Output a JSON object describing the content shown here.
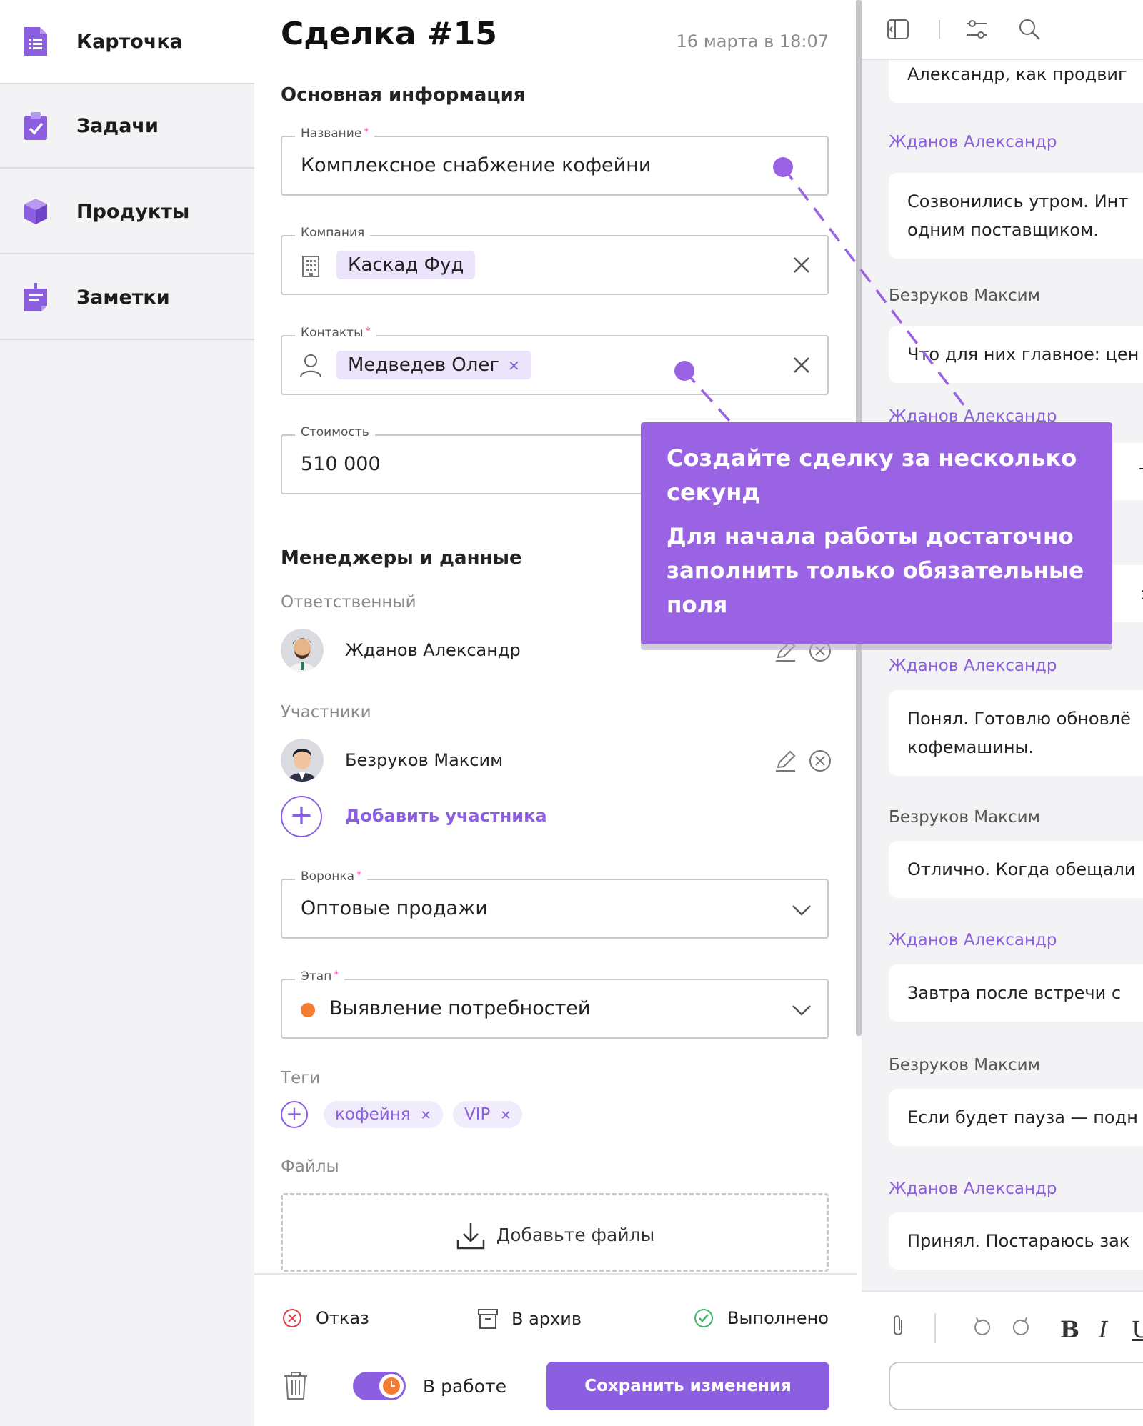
{
  "sidebar": {
    "items": [
      {
        "label": "Карточка",
        "icon": "card-document-icon",
        "active": true
      },
      {
        "label": "Задачи",
        "icon": "task-clipboard-icon",
        "active": false
      },
      {
        "label": "Продукты",
        "icon": "product-box-icon",
        "active": false
      },
      {
        "label": "Заметки",
        "icon": "note-icon",
        "active": false
      }
    ]
  },
  "deal": {
    "title": "Сделка #15",
    "date": "16 марта в 18:07"
  },
  "main_info": {
    "section_title": "Основная информация",
    "name": {
      "label": "Название",
      "required_mark": "*",
      "value": "Комплексное снабжение кофейни"
    },
    "company": {
      "label": "Компания",
      "value": "Каскад Фуд"
    },
    "contacts": {
      "label": "Контакты",
      "required_mark": "*",
      "value": "Медведев Олег"
    },
    "cost": {
      "label": "Стоимость",
      "value": "510 000"
    }
  },
  "managers": {
    "section_title": "Менеджеры и данные",
    "responsible_label": "Ответственный",
    "responsible": "Жданов Александр",
    "participants_label": "Участники",
    "participants": [
      "Безруков Максим"
    ],
    "add_participant": "Добавить участника"
  },
  "pipeline": {
    "label": "Воронка",
    "required_mark": "*",
    "value": "Оптовые продажи"
  },
  "stage": {
    "label": "Этап",
    "required_mark": "*",
    "value": "Выявление потребностей",
    "dot_color": "#f47b30"
  },
  "tags": {
    "label": "Теги",
    "items": [
      "кофейня",
      "VIP"
    ]
  },
  "files": {
    "label": "Файлы",
    "dropzone": "Добавьте файлы"
  },
  "footer": {
    "reject": "Отказ",
    "archive": "В архив",
    "done": "Выполнено",
    "status": "В работе",
    "save": "Сохранить изменения"
  },
  "chat": {
    "messages": [
      {
        "author": "",
        "text": "Александр, как продвиг"
      },
      {
        "author": "Жданов Александр",
        "text": "Созвонились утром. Инт\nодним поставщиком."
      },
      {
        "author": "Безруков Максим",
        "text": "Что для них главное: цен"
      },
      {
        "author": "Жданов Александр",
        "text": "тоб"
      },
      {
        "author": "",
        "text": "экс"
      },
      {
        "author": "Жданов Александр",
        "text": "Понял. Готовлю обновлё\nкофемашины."
      },
      {
        "author": "Безруков Максим",
        "text": "Отлично. Когда обещали"
      },
      {
        "author": "Жданов Александр",
        "text": "Завтра после встречи с"
      },
      {
        "author": "Безруков Максим",
        "text": "Если будет пауза — подн"
      },
      {
        "author": "Жданов Александр",
        "text": "Принял. Постараюсь зак"
      }
    ],
    "format": {
      "bold": "B",
      "italic": "I",
      "underline": "U"
    }
  },
  "tooltip": {
    "title": "Создайте сделку за несколько секунд",
    "body": "Для начала работы достаточно заполнить только обязательные поля"
  },
  "colors": {
    "accent": "#8b5fe0",
    "tooltip": "#9a63e3",
    "reject": "#e0404a",
    "done": "#3fb56b"
  }
}
